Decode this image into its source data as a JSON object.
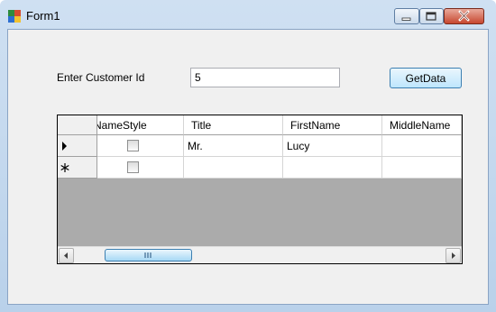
{
  "window": {
    "title": "Form1"
  },
  "form": {
    "customer_label": "Enter Customer Id",
    "customer_id_value": "5",
    "getdata_label": "GetData"
  },
  "grid": {
    "columns": [
      "NameStyle",
      "Title",
      "FirstName",
      "MiddleName"
    ],
    "rows": [
      {
        "namestyle": false,
        "title": "Mr.",
        "firstname": "Lucy",
        "middlename": "",
        "row_marker": "current"
      },
      {
        "namestyle": false,
        "title": "",
        "firstname": "",
        "middlename": "",
        "row_marker": "new"
      }
    ]
  },
  "icons": {
    "app": "form-app-icon",
    "minimize": "minimize-icon",
    "maximize": "maximize-icon",
    "close": "close-icon",
    "current_row": "triangle-right-icon",
    "new_row": "asterisk-icon",
    "scroll_left": "arrow-left-icon",
    "scroll_right": "arrow-right-icon",
    "thumb_grip": "grip-icon"
  },
  "colors": {
    "titlebar": "#c3d7ee",
    "close_button": "#c7472f",
    "accent_button": "#bee6fd",
    "grid_background": "#ababab"
  }
}
